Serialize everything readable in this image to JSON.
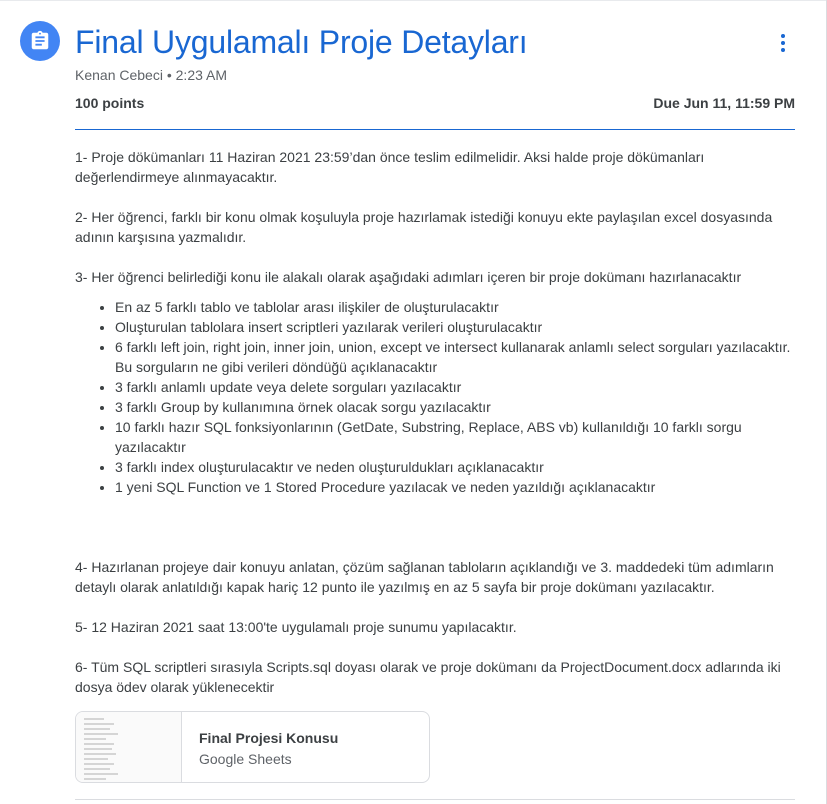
{
  "header": {
    "title": "Final Uygulamalı Proje Detayları",
    "author": "Kenan Cebeci",
    "separator": "•",
    "time": "2:23 AM",
    "points": "100 points",
    "due": "Due Jun 11, 11:59 PM"
  },
  "body": {
    "p1": "1- Proje dökümanları 11 Haziran 2021 23:59’dan önce teslim edilmelidir. Aksi halde proje dökümanları değerlendirmeye alınmayacaktır.",
    "p2": "2- Her öğrenci, farklı bir konu olmak koşuluyla proje hazırlamak istediği konuyu ekte paylaşılan excel dosyasında adının karşısına yazmalıdır.",
    "p3": "3- Her öğrenci belirlediği konu ile alakalı olarak aşağıdaki adımları içeren bir proje dokümanı hazırlanacaktır",
    "bullets": [
      "En az 5 farklı tablo ve tablolar arası ilişkiler de oluşturulacaktır",
      "Oluşturulan tablolara insert scriptleri yazılarak verileri oluşturulacaktır",
      "6 farklı left join, right join, inner join, union, except ve intersect kullanarak anlamlı select sorguları yazılacaktır. Bu sorguların ne gibi verileri döndüğü açıklanacaktır",
      "3 farklı anlamlı update veya delete sorguları yazılacaktır",
      "3 farklı Group by kullanımına örnek olacak sorgu yazılacaktır",
      "10 farklı hazır SQL fonksiyonlarının (GetDate, Substring, Replace, ABS vb) kullanıldığı 10 farklı sorgu yazılacaktır",
      "3 farklı index oluşturulacaktır ve neden oluşturuldukları açıklanacaktır",
      "1 yeni SQL Function ve 1 Stored Procedure yazılacak ve neden yazıldığı açıklanacaktır"
    ],
    "p4": "4-  Hazırlanan projeye dair konuyu anlatan, çözüm sağlanan tabloların açıklandığı ve 3. maddedeki tüm adımların detaylı olarak anlatıldığı kapak hariç 12 punto ile yazılmış en az 5 sayfa bir proje dokümanı yazılacaktır.",
    "p5": "5- 12 Haziran 2021 saat 13:00'te uygulamalı proje sunumu yapılacaktır.",
    "p6": "6- Tüm SQL scriptleri sırasıyla Scripts.sql doyası olarak ve proje dokümanı da ProjectDocument.docx adlarında iki dosya ödev olarak yüklenecektir"
  },
  "attachment": {
    "title": "Final Projesi Konusu",
    "type": "Google Sheets"
  },
  "colors": {
    "accent": "#1967d2",
    "icon_bg": "#4285f4"
  },
  "icons": {
    "assignment": "assignment-icon",
    "more": "more-vert-icon"
  }
}
